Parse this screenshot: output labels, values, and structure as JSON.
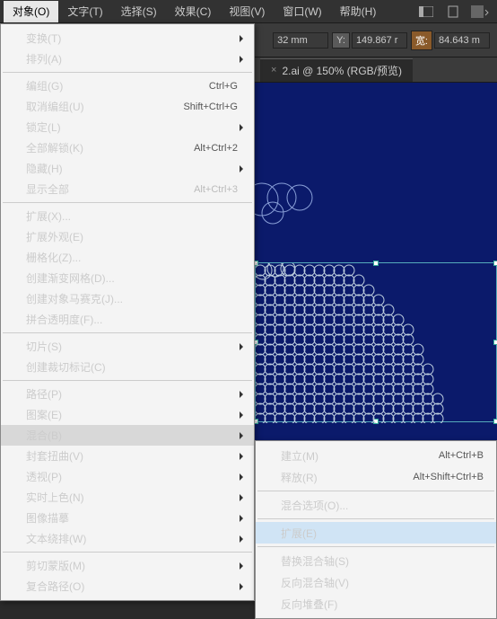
{
  "menubar": {
    "items": [
      "对象(O)",
      "文字(T)",
      "选择(S)",
      "效果(C)",
      "视图(V)",
      "窗口(W)",
      "帮助(H)"
    ]
  },
  "toolbar": {
    "x_suffix": "32 mm",
    "y_label": "Y:",
    "y_value": "149.867 r",
    "w_label": "宽:",
    "w_value": "84.643 m"
  },
  "doctab": {
    "title": "2.ai @ 150% (RGB/预览)",
    "close": "×"
  },
  "menu": {
    "items": [
      {
        "label": "变换(T)",
        "sub": true
      },
      {
        "label": "排列(A)",
        "sub": true
      },
      {
        "sep": true
      },
      {
        "label": "编组(G)",
        "sc": "Ctrl+G"
      },
      {
        "label": "取消编组(U)",
        "sc": "Shift+Ctrl+G"
      },
      {
        "label": "锁定(L)",
        "sub": true
      },
      {
        "label": "全部解锁(K)",
        "sc": "Alt+Ctrl+2"
      },
      {
        "label": "隐藏(H)",
        "sub": true
      },
      {
        "label": "显示全部",
        "sc": "Alt+Ctrl+3",
        "disabled": true
      },
      {
        "sep": true
      },
      {
        "label": "扩展(X)..."
      },
      {
        "label": "扩展外观(E)",
        "disabled": true
      },
      {
        "label": "栅格化(Z)..."
      },
      {
        "label": "创建渐变网格(D)..."
      },
      {
        "label": "创建对象马赛克(J)..."
      },
      {
        "label": "拼合透明度(F)..."
      },
      {
        "sep": true
      },
      {
        "label": "切片(S)",
        "sub": true
      },
      {
        "label": "创建裁切标记(C)"
      },
      {
        "sep": true
      },
      {
        "label": "路径(P)",
        "sub": true
      },
      {
        "label": "图案(E)",
        "sub": true
      },
      {
        "label": "混合(B)",
        "sub": true,
        "highlight": true
      },
      {
        "label": "封套扭曲(V)",
        "sub": true
      },
      {
        "label": "透视(P)",
        "sub": true
      },
      {
        "label": "实时上色(N)",
        "sub": true
      },
      {
        "label": "图像描摹",
        "sub": true
      },
      {
        "label": "文本绕排(W)",
        "sub": true
      },
      {
        "sep": true
      },
      {
        "label": "剪切蒙版(M)",
        "sub": true
      },
      {
        "label": "复合路径(O)",
        "sub": true
      }
    ]
  },
  "submenu": {
    "items": [
      {
        "label": "建立(M)",
        "sc": "Alt+Ctrl+B"
      },
      {
        "label": "释放(R)",
        "sc": "Alt+Shift+Ctrl+B"
      },
      {
        "sep": true
      },
      {
        "label": "混合选项(O)..."
      },
      {
        "sep": true
      },
      {
        "label": "扩展(E)",
        "highlight": true
      },
      {
        "sep": true
      },
      {
        "label": "替换混合轴(S)",
        "disabled": true
      },
      {
        "label": "反向混合轴(V)"
      },
      {
        "label": "反向堆叠(F)"
      }
    ]
  }
}
